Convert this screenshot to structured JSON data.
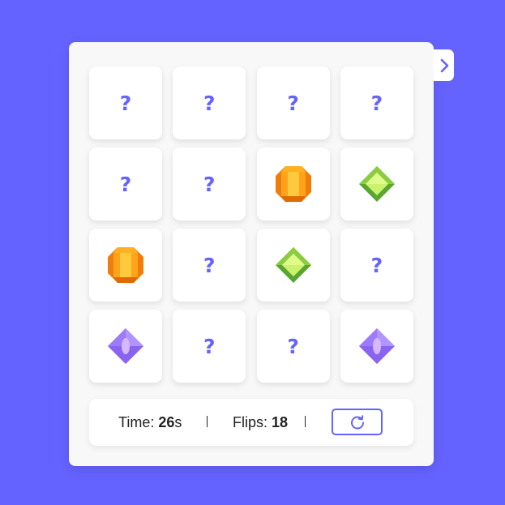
{
  "board": {
    "cards": [
      {
        "state": "hidden",
        "label": "?"
      },
      {
        "state": "hidden",
        "label": "?"
      },
      {
        "state": "hidden",
        "label": "?"
      },
      {
        "state": "hidden",
        "label": "?"
      },
      {
        "state": "hidden",
        "label": "?"
      },
      {
        "state": "hidden",
        "label": "?"
      },
      {
        "state": "revealed",
        "icon": "orange-gem-icon"
      },
      {
        "state": "revealed",
        "icon": "green-gem-icon"
      },
      {
        "state": "revealed",
        "icon": "orange-gem-icon"
      },
      {
        "state": "hidden",
        "label": "?"
      },
      {
        "state": "revealed",
        "icon": "green-gem-icon"
      },
      {
        "state": "hidden",
        "label": "?"
      },
      {
        "state": "revealed",
        "icon": "purple-gem-icon"
      },
      {
        "state": "hidden",
        "label": "?"
      },
      {
        "state": "hidden",
        "label": "?"
      },
      {
        "state": "revealed",
        "icon": "purple-gem-icon"
      }
    ]
  },
  "stats": {
    "time_label": "Time: ",
    "time_value": "26",
    "time_unit": "s",
    "flips_label": "Flips: ",
    "flips_value": "18"
  },
  "controls": {
    "restart_icon": "refresh-icon",
    "toggle_icon": "chevron-right-icon"
  },
  "colors": {
    "background": "#6563ff",
    "accent": "#6563ff",
    "panel": "#f8f8f8",
    "card": "#ffffff"
  }
}
